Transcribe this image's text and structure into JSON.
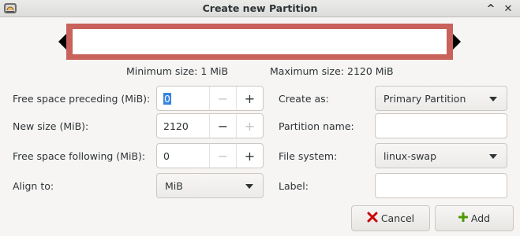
{
  "window": {
    "title": "Create new Partition",
    "minimize_glyph": "^",
    "close_glyph": "✕"
  },
  "size_info": {
    "minimum": "Minimum size: 1 MiB",
    "maximum": "Maximum size: 2120 MiB"
  },
  "left": {
    "free_preceding": {
      "label": "Free space preceding (MiB):",
      "value": "0",
      "minus": "−",
      "plus": "+"
    },
    "new_size": {
      "label": "New size (MiB):",
      "value": "2120",
      "minus": "−",
      "plus": "+"
    },
    "free_following": {
      "label": "Free space following (MiB):",
      "value": "0",
      "minus": "−",
      "plus": "+"
    },
    "align_to": {
      "label": "Align to:",
      "value": "MiB"
    }
  },
  "right": {
    "create_as": {
      "label": "Create as:",
      "value": "Primary Partition"
    },
    "partition_name": {
      "label": "Partition name:",
      "value": ""
    },
    "file_system": {
      "label": "File system:",
      "value": "linux-swap"
    },
    "fs_label": {
      "label": "Label:",
      "value": ""
    }
  },
  "buttons": {
    "cancel": "Cancel",
    "add": "Add"
  },
  "colors": {
    "partition_border": "#c8625a",
    "selection": "#3584e4",
    "cancel_icon": "#cc0000",
    "add_icon": "#4e9a06"
  }
}
